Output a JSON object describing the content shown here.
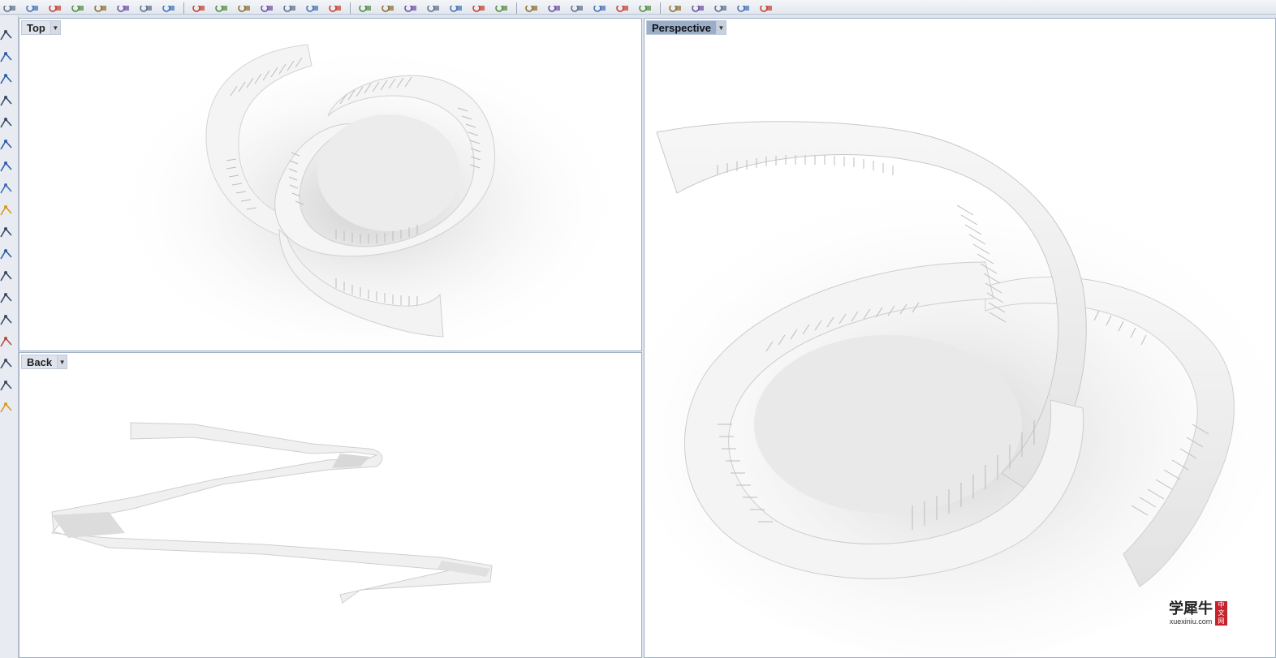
{
  "toolbar": {
    "icons": [
      "select-icon",
      "zoom-window-icon",
      "zoom-extents-icon",
      "zoom-in-icon",
      "zoom-out-icon",
      "zoom-selected-icon",
      "zoom-all-icon",
      "undo-view-icon",
      "lock-icon",
      "trash-icon",
      "render-icon",
      "render-preview-icon",
      "viewport-icon",
      "lights-icon",
      "material-icon",
      "car-icon",
      "camera-icon",
      "vehicle-icon",
      "folder-icon",
      "sphere-icon",
      "plane-icon",
      "osnap-icon",
      "gumball-icon",
      "pen-icon",
      "gear-icon",
      "pin-icon",
      "monitor-icon",
      "arrow-icon",
      "record-icon",
      "rotate-icon",
      "curve-icon",
      "star-icon",
      "compass-icon"
    ]
  },
  "left_toolbar": {
    "icons": [
      "point-icon",
      "polyline-icon",
      "curve-icon",
      "rectangle-icon",
      "arc-icon",
      "surface-icon",
      "sphere-icon",
      "extrude-icon",
      "lightning-icon",
      "dimension-icon",
      "group-icon",
      "curve-tools-icon",
      "transform-icon",
      "pen-icon",
      "array-icon",
      "grid-icon",
      "move-icon",
      "paint-icon"
    ]
  },
  "viewports": {
    "top": {
      "label": "Top"
    },
    "back": {
      "label": "Back"
    },
    "perspective": {
      "label": "Perspective"
    }
  },
  "watermark": {
    "chinese": "学犀牛",
    "url": "xuexiniu.com",
    "seal": [
      "中",
      "文",
      "网"
    ]
  },
  "colors": {
    "background": "#dfe5ee",
    "active_label": "#9aaecb",
    "viewport_bg": "#ffffff",
    "model_fill": "#f2f2f2"
  }
}
